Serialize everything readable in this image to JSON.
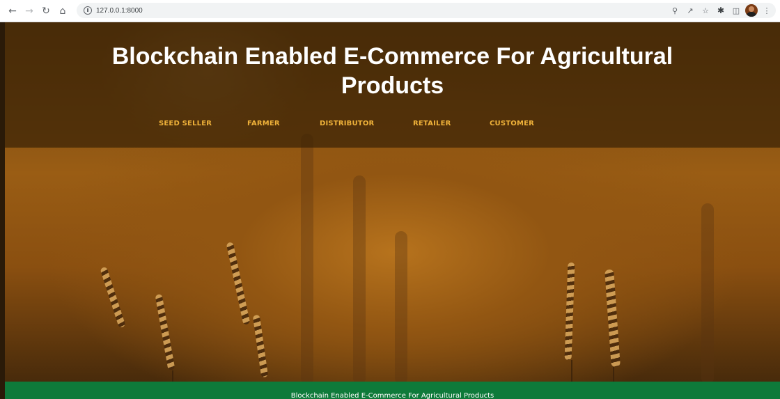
{
  "browser": {
    "url": "127.0.0.1:8000",
    "nav_icons": [
      "back-icon",
      "forward-icon",
      "reload-icon",
      "home-icon"
    ],
    "toolbar_icons": [
      "zoom-icon",
      "share-icon",
      "bookmark-star-icon",
      "extensions-icon",
      "side-panel-icon",
      "profile-avatar",
      "menu-icon"
    ]
  },
  "site": {
    "title_line1": "Blockchain Enabled E-Commerce For Agricultural",
    "title_line2": "Products",
    "nav": [
      {
        "label": "SEED SELLER"
      },
      {
        "label": "FARMER"
      },
      {
        "label": "DISTRIBUTOR"
      },
      {
        "label": "RETAILER"
      },
      {
        "label": "CUSTOMER"
      }
    ],
    "footer": "Blockchain Enabled E-Commerce For Agricultural Products"
  },
  "colors": {
    "nav_link": "#f0b23a",
    "footer_bg": "#0e7a3a",
    "title": "#ffffff"
  }
}
